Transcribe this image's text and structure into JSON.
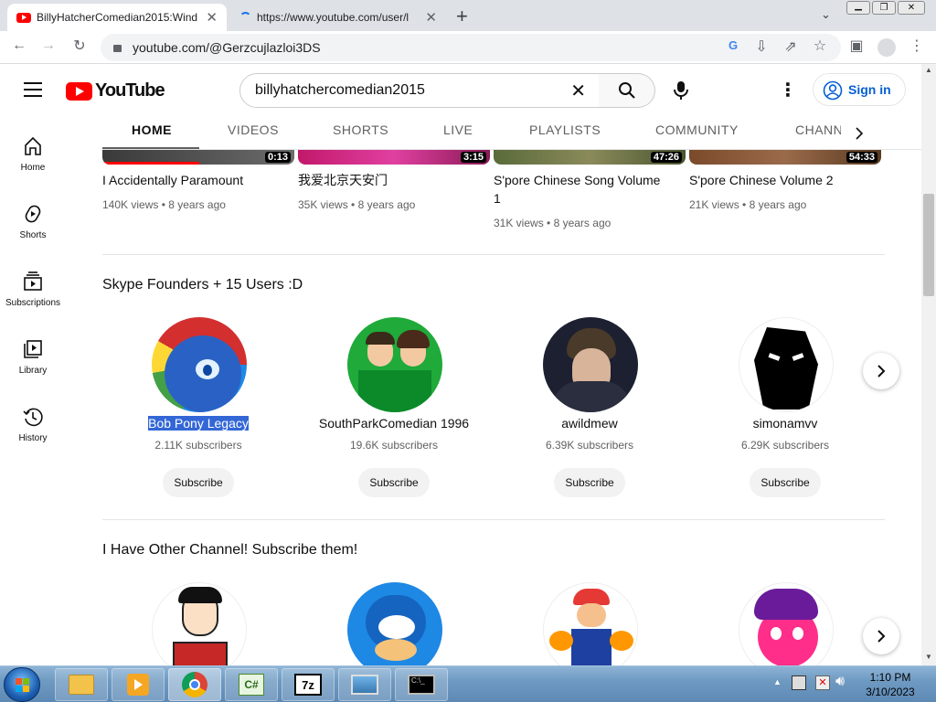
{
  "browser": {
    "tabs": [
      {
        "title": "BillyHatcherComedian2015:Wind"
      },
      {
        "title": "https://www.youtube.com/user/l"
      }
    ],
    "url": "youtube.com/@Gerzcujlazloi3DS"
  },
  "youtube": {
    "logo": "YouTube",
    "search_value": "billyhatchercomedian2015",
    "signin_label": "Sign in",
    "channel_tabs": [
      "HOME",
      "VIDEOS",
      "SHORTS",
      "LIVE",
      "PLAYLISTS",
      "COMMUNITY",
      "CHANN"
    ],
    "selected_tab": "HOME",
    "sidebar": [
      {
        "label": "Home",
        "icon": "home-icon"
      },
      {
        "label": "Shorts",
        "icon": "shorts-icon"
      },
      {
        "label": "Subscriptions",
        "icon": "subscriptions-icon"
      },
      {
        "label": "Library",
        "icon": "library-icon"
      },
      {
        "label": "History",
        "icon": "history-icon"
      }
    ],
    "videos": [
      {
        "title": "I Accidentally Paramount",
        "duration": "0:13",
        "views": "140K views",
        "age": "8 years ago"
      },
      {
        "title": "我爱北京天安门",
        "duration": "3:15",
        "views": "35K views",
        "age": "8 years ago"
      },
      {
        "title_line1": "S'pore Chinese Song Volume",
        "title_line2": "1",
        "duration": "47:26",
        "views": "31K views",
        "age": "8 years ago"
      },
      {
        "title": "S'pore Chinese Volume 2",
        "duration": "54:33",
        "views": "21K views",
        "age": "8 years ago"
      }
    ],
    "sections": [
      {
        "title": "Skype Founders + 15 Users :D",
        "channels": [
          {
            "name": "Bob Pony Legacy",
            "subscribers": "2.11K subscribers",
            "button": "Subscribe"
          },
          {
            "name": "SouthParkComedian 1996",
            "subscribers": "19.6K subscribers",
            "button": "Subscribe"
          },
          {
            "name": "awildmew",
            "subscribers": "6.39K subscribers",
            "button": "Subscribe"
          },
          {
            "name": "simonamvv",
            "subscribers": "6.29K subscribers",
            "button": "Subscribe"
          }
        ]
      },
      {
        "title": "I Have Other Channel! Subscribe them!"
      }
    ]
  },
  "taskbar": {
    "time": "1:10 PM",
    "date": "3/10/2023"
  },
  "colors": {
    "youtube_red": "#ff0000",
    "link_blue": "#065fd4",
    "chrome_tabstrip": "#dee1e6"
  }
}
